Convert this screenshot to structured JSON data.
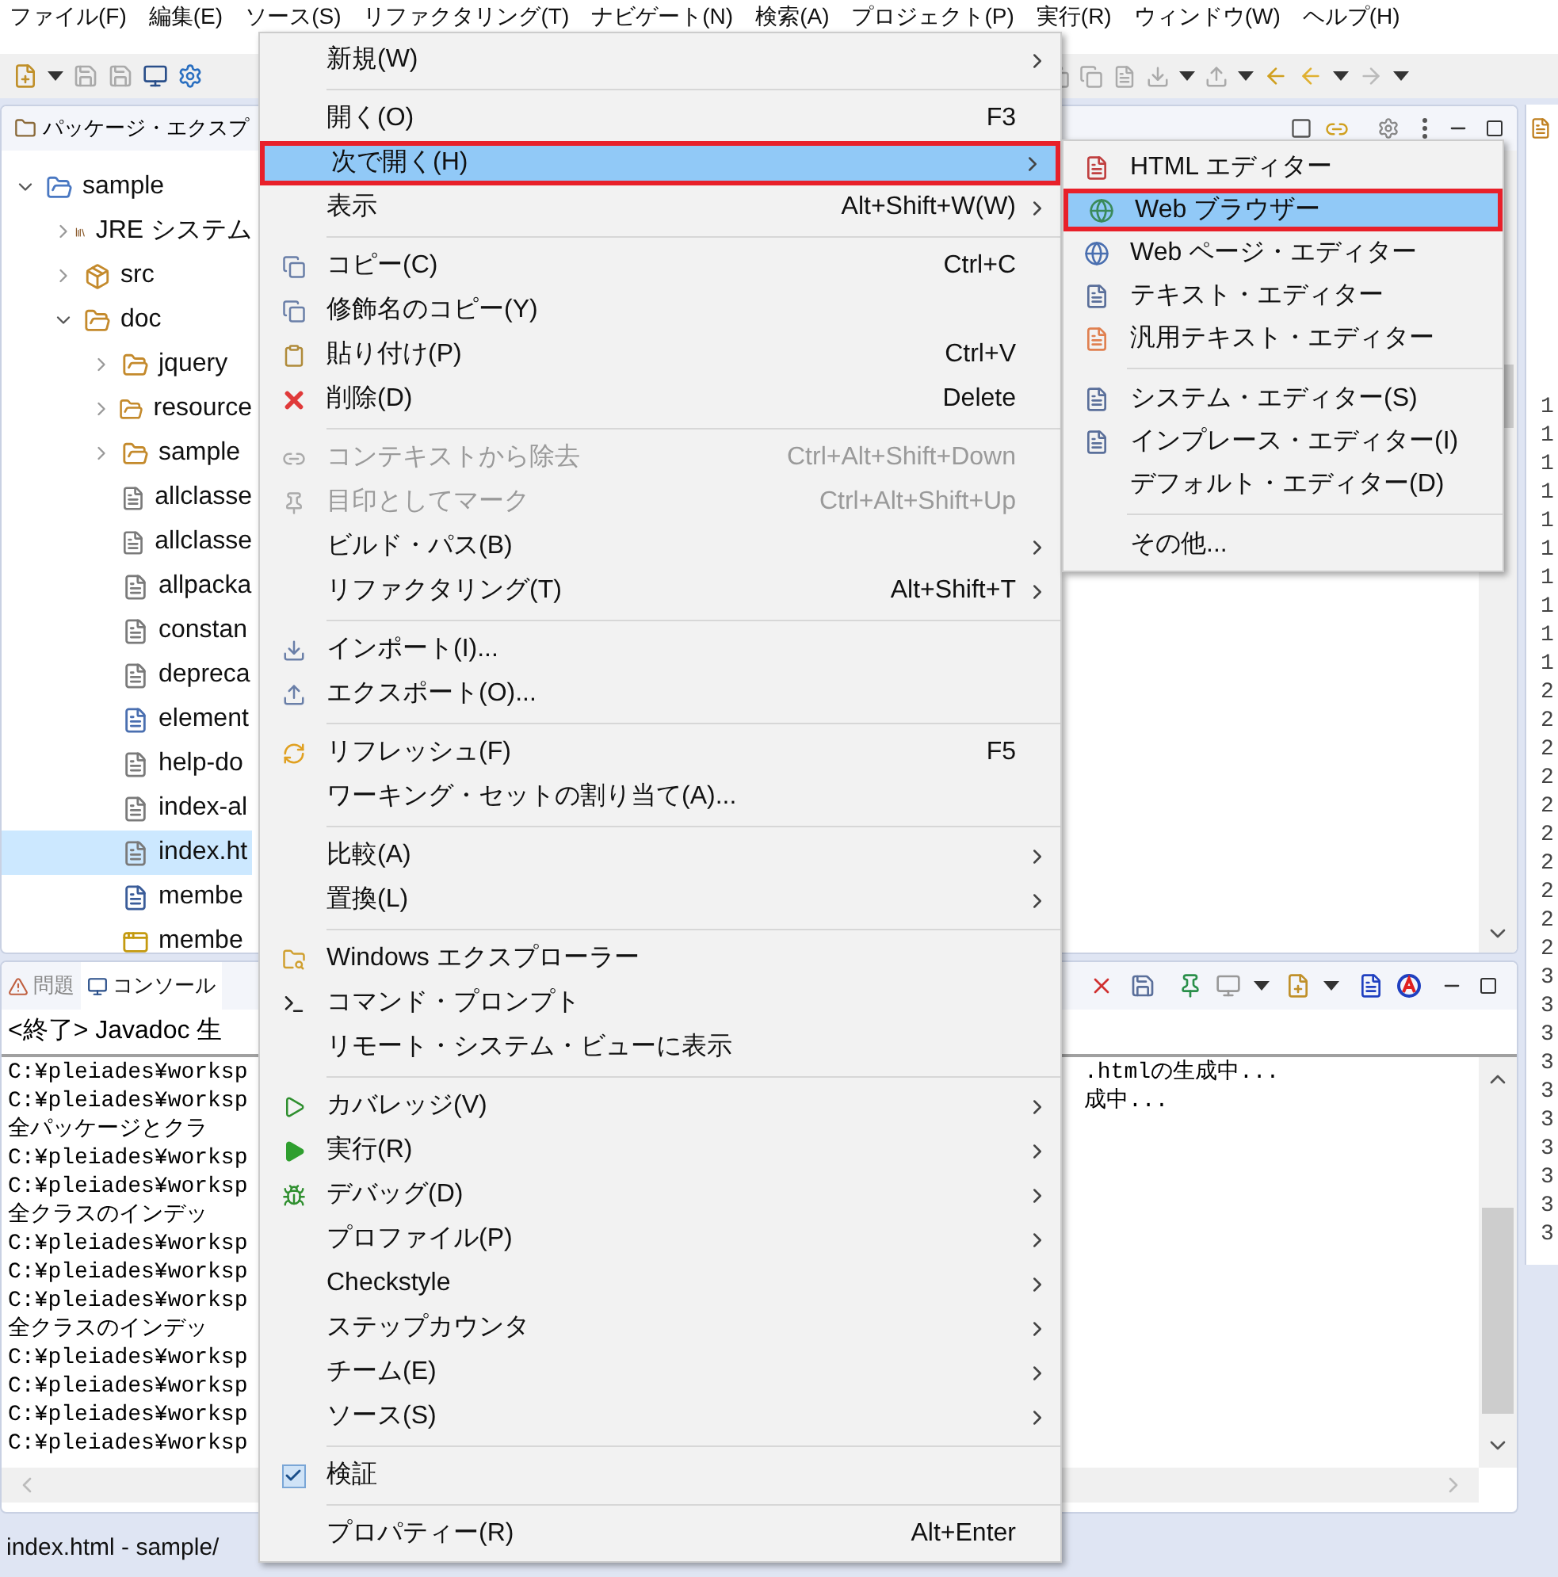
{
  "menu_bar": [
    "ファイル(F)",
    "編集(E)",
    "ソース(S)",
    "リファクタリング(T)",
    "ナビゲート(N)",
    "検索(A)",
    "プロジェクト(P)",
    "実行(R)",
    "ウィンドウ(W)",
    "ヘルプ(H)"
  ],
  "package_explorer": {
    "title": "パッケージ・エクスプ",
    "tree": [
      {
        "label": "sample",
        "kind": "project",
        "expanded": true,
        "selected": false,
        "children": [
          {
            "label": "JRE システム",
            "kind": "library",
            "expanded": false,
            "selected": false
          },
          {
            "label": "src",
            "kind": "source",
            "expanded": false,
            "selected": false
          },
          {
            "label": "doc",
            "kind": "folder",
            "expanded": true,
            "selected": false,
            "children": [
              {
                "label": "jquery",
                "kind": "folder",
                "expanded": false,
                "selected": false
              },
              {
                "label": "resource",
                "kind": "folder",
                "expanded": false,
                "selected": false
              },
              {
                "label": "sample",
                "kind": "folder",
                "expanded": false,
                "selected": false
              },
              {
                "label": "allclasse",
                "kind": "html",
                "selected": false
              },
              {
                "label": "allclasse",
                "kind": "html",
                "selected": false
              },
              {
                "label": "allpacka",
                "kind": "html",
                "selected": false
              },
              {
                "label": "constan",
                "kind": "html",
                "selected": false
              },
              {
                "label": "depreca",
                "kind": "html",
                "selected": false
              },
              {
                "label": "element",
                "kind": "text",
                "selected": false
              },
              {
                "label": "help-do",
                "kind": "html",
                "selected": false
              },
              {
                "label": "index-al",
                "kind": "html",
                "selected": false
              },
              {
                "label": "index.ht",
                "kind": "html",
                "selected": true
              },
              {
                "label": "membe",
                "kind": "class",
                "selected": false
              },
              {
                "label": "membe",
                "kind": "frame",
                "selected": false
              }
            ]
          }
        ]
      }
    ]
  },
  "console": {
    "tabs": [
      {
        "label": "問題",
        "selected": false
      },
      {
        "label": "コンソール",
        "selected": true
      }
    ],
    "header": "<終了> Javadoc 生",
    "lines": [
      {
        "text": "C:¥pleiades¥worksp",
        "tail": ".htmlの生成中..."
      },
      {
        "text": "C:¥pleiades¥worksp",
        "tail": "成中..."
      },
      {
        "text": "全パッケージとクラ"
      },
      {
        "text": "C:¥pleiades¥worksp"
      },
      {
        "text": "C:¥pleiades¥worksp"
      },
      {
        "text": "全クラスのインデッ"
      },
      {
        "text": "C:¥pleiades¥worksp"
      },
      {
        "text": "C:¥pleiades¥worksp"
      },
      {
        "text": "C:¥pleiades¥worksp"
      },
      {
        "text": "全クラスのインデッ"
      },
      {
        "text": "C:¥pleiades¥worksp"
      },
      {
        "text": "C:¥pleiades¥worksp"
      },
      {
        "text": "C:¥pleiades¥worksp"
      },
      {
        "text": "C:¥pleiades¥worksp"
      }
    ]
  },
  "editor_gutter": [
    "1",
    "1",
    "1",
    "1",
    "1",
    "1",
    "1",
    "1",
    "1",
    "1",
    "2",
    "2",
    "2",
    "2",
    "2",
    "2",
    "2",
    "2",
    "2",
    "2",
    "3",
    "3",
    "3",
    "3",
    "3",
    "3",
    "3",
    "3",
    "3",
    "3"
  ],
  "status_bar": "index.html - sample/",
  "context_menu": [
    {
      "kind": "item",
      "label": "新規(W)",
      "submenu": true,
      "selected": false,
      "disabled": false
    },
    {
      "kind": "separator"
    },
    {
      "kind": "item",
      "label": "開く(O)",
      "shortcut": "F3",
      "submenu": false,
      "selected": false,
      "disabled": false
    },
    {
      "kind": "item",
      "label": "次で開く(H)",
      "submenu": true,
      "selected": true,
      "disabled": false
    },
    {
      "kind": "item",
      "label": "表示",
      "shortcut": "Alt+Shift+W(W)",
      "submenu": true,
      "selected": false,
      "disabled": false
    },
    {
      "kind": "separator"
    },
    {
      "kind": "item",
      "label": "コピー(C)",
      "shortcut": "Ctrl+C",
      "submenu": false,
      "selected": false,
      "disabled": false
    },
    {
      "kind": "item",
      "label": "修飾名のコピー(Y)",
      "submenu": false,
      "selected": false,
      "disabled": false
    },
    {
      "kind": "item",
      "label": "貼り付け(P)",
      "shortcut": "Ctrl+V",
      "submenu": false,
      "selected": false,
      "disabled": false
    },
    {
      "kind": "item",
      "label": "削除(D)",
      "shortcut": "Delete",
      "submenu": false,
      "selected": false,
      "disabled": false
    },
    {
      "kind": "separator"
    },
    {
      "kind": "item",
      "label": "コンテキストから除去",
      "shortcut": "Ctrl+Alt+Shift+Down",
      "submenu": false,
      "selected": false,
      "disabled": true
    },
    {
      "kind": "item",
      "label": "目印としてマーク",
      "shortcut": "Ctrl+Alt+Shift+Up",
      "submenu": false,
      "selected": false,
      "disabled": true
    },
    {
      "kind": "item",
      "label": "ビルド・パス(B)",
      "submenu": true,
      "selected": false,
      "disabled": false
    },
    {
      "kind": "item",
      "label": "リファクタリング(T)",
      "shortcut": "Alt+Shift+T",
      "submenu": true,
      "selected": false,
      "disabled": false
    },
    {
      "kind": "separator"
    },
    {
      "kind": "item",
      "label": "インポート(I)...",
      "submenu": false,
      "selected": false,
      "disabled": false
    },
    {
      "kind": "item",
      "label": "エクスポート(O)...",
      "submenu": false,
      "selected": false,
      "disabled": false
    },
    {
      "kind": "separator"
    },
    {
      "kind": "item",
      "label": "リフレッシュ(F)",
      "shortcut": "F5",
      "submenu": false,
      "selected": false,
      "disabled": false
    },
    {
      "kind": "item",
      "label": "ワーキング・セットの割り当て(A)...",
      "submenu": false,
      "selected": false,
      "disabled": false
    },
    {
      "kind": "separator"
    },
    {
      "kind": "item",
      "label": "比較(A)",
      "submenu": true,
      "selected": false,
      "disabled": false
    },
    {
      "kind": "item",
      "label": "置換(L)",
      "submenu": true,
      "selected": false,
      "disabled": false
    },
    {
      "kind": "separator"
    },
    {
      "kind": "item",
      "label": "Windows エクスプローラー",
      "submenu": false,
      "selected": false,
      "disabled": false
    },
    {
      "kind": "item",
      "label": "コマンド・プロンプト",
      "submenu": false,
      "selected": false,
      "disabled": false
    },
    {
      "kind": "item",
      "label": "リモート・システム・ビューに表示",
      "submenu": false,
      "selected": false,
      "disabled": false
    },
    {
      "kind": "separator"
    },
    {
      "kind": "item",
      "label": "カバレッジ(V)",
      "submenu": true,
      "selected": false,
      "disabled": false
    },
    {
      "kind": "item",
      "label": "実行(R)",
      "submenu": true,
      "selected": false,
      "disabled": false
    },
    {
      "kind": "item",
      "label": "デバッグ(D)",
      "submenu": true,
      "selected": false,
      "disabled": false
    },
    {
      "kind": "item",
      "label": "プロファイル(P)",
      "submenu": true,
      "selected": false,
      "disabled": false
    },
    {
      "kind": "item",
      "label": "Checkstyle",
      "submenu": true,
      "selected": false,
      "disabled": false
    },
    {
      "kind": "item",
      "label": "ステップカウンタ",
      "submenu": true,
      "selected": false,
      "disabled": false
    },
    {
      "kind": "item",
      "label": "チーム(E)",
      "submenu": true,
      "selected": false,
      "disabled": false
    },
    {
      "kind": "item",
      "label": "ソース(S)",
      "submenu": true,
      "selected": false,
      "disabled": false
    },
    {
      "kind": "separator"
    },
    {
      "kind": "check",
      "label": "検証",
      "checked": true,
      "selected": false,
      "disabled": false
    },
    {
      "kind": "separator"
    },
    {
      "kind": "item",
      "label": "プロパティー(R)",
      "shortcut": "Alt+Enter",
      "submenu": false,
      "selected": false,
      "disabled": false
    }
  ],
  "open_with_menu": [
    {
      "kind": "item",
      "label": "HTML エディター",
      "selected": false
    },
    {
      "kind": "item",
      "label": "Web ブラウザー",
      "selected": true
    },
    {
      "kind": "item",
      "label": "Web ページ・エディター",
      "selected": false
    },
    {
      "kind": "item",
      "label": "テキスト・エディター",
      "selected": false
    },
    {
      "kind": "item",
      "label": "汎用テキスト・エディター",
      "selected": false
    },
    {
      "kind": "separator"
    },
    {
      "kind": "item",
      "label": "システム・エディター(S)",
      "selected": false
    },
    {
      "kind": "item",
      "label": "インプレース・エディター(I)",
      "selected": false
    },
    {
      "kind": "item",
      "label": "デフォルト・エディター(D)",
      "selected": false
    },
    {
      "kind": "separator"
    },
    {
      "kind": "item",
      "label": "その他...",
      "selected": false
    }
  ]
}
